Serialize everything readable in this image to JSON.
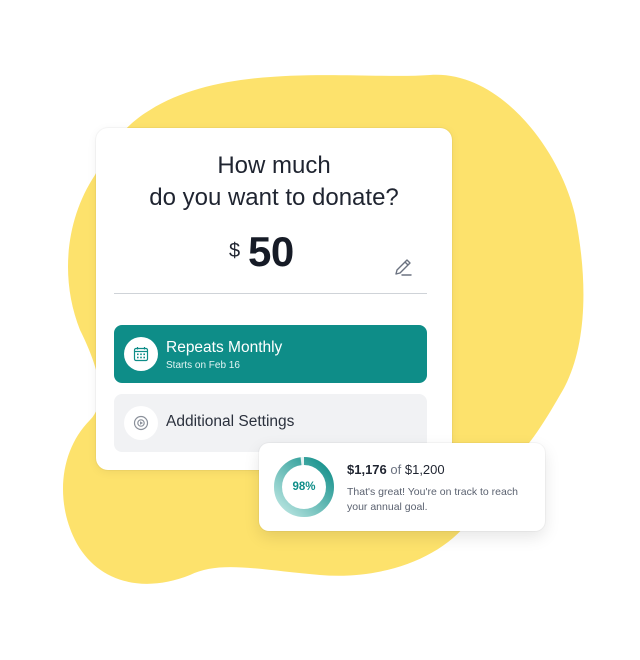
{
  "donation": {
    "title_line1": "How much",
    "title_line2": "do you want to donate?",
    "currency_symbol": "$",
    "amount": "50",
    "edit_icon": "pencil-icon"
  },
  "frequency": {
    "label": "Repeats Monthly",
    "sublabel": "Starts on Feb 16",
    "icon": "calendar-icon"
  },
  "settings": {
    "label": "Additional Settings",
    "icon": "settings-icon"
  },
  "goal": {
    "percent": 98,
    "percent_label": "98%",
    "current": "$1,176",
    "of_word": "of",
    "target": "$1,200",
    "message": "That's great! You're on track to reach your annual goal."
  },
  "colors": {
    "accent": "#0e8d88",
    "blob": "#fde26c"
  }
}
